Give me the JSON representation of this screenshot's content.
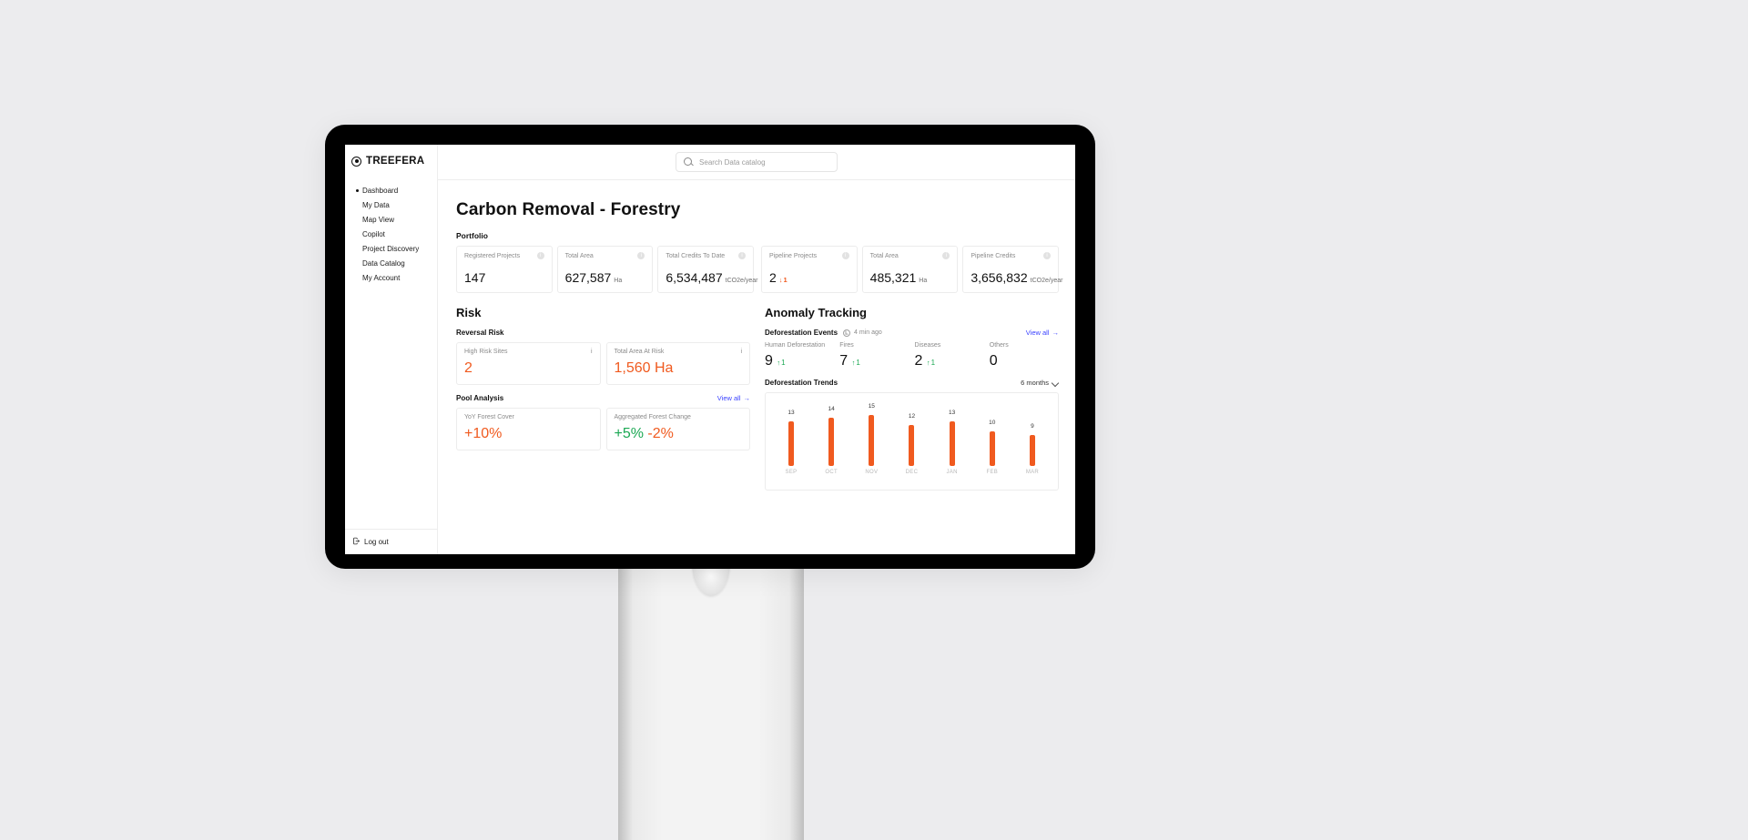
{
  "brand": "TREEFERA",
  "search": {
    "placeholder": "Search Data catalog"
  },
  "sidebar": {
    "items": [
      {
        "label": "Dashboard",
        "active": true
      },
      {
        "label": "My Data"
      },
      {
        "label": "Map View"
      },
      {
        "label": "Copilot"
      },
      {
        "label": "Project Discovery"
      },
      {
        "label": "Data Catalog"
      },
      {
        "label": "My Account"
      }
    ],
    "logout_label": "Log out"
  },
  "page": {
    "title": "Carbon Removal - Forestry"
  },
  "portfolio": {
    "title": "Portfolio",
    "left": [
      {
        "label": "Registered Projects",
        "value": "147"
      },
      {
        "label": "Total Area",
        "value": "627,587",
        "unit": "Ha"
      },
      {
        "label": "Total Credits To Date",
        "value": "6,534,487",
        "unit": "tCO2e/year"
      }
    ],
    "right": [
      {
        "label": "Pipeline Projects",
        "value": "2",
        "delta_dir": "down",
        "delta": "1"
      },
      {
        "label": "Total Area",
        "value": "485,321",
        "unit": "Ha"
      },
      {
        "label": "Pipeline Credits",
        "value": "3,656,832",
        "unit": "tCO2e/year"
      }
    ]
  },
  "risk": {
    "title": "Risk",
    "reversal": {
      "title": "Reversal Risk",
      "items": [
        {
          "label": "High Risk Sites",
          "value": "2",
          "color": "orange"
        },
        {
          "label": "Total Area At Risk",
          "value": "1,560",
          "unit": "Ha",
          "color": "orange"
        }
      ]
    },
    "pool": {
      "title": "Pool Analysis",
      "view_all": "View all",
      "items": [
        {
          "label": "YoY Forest Cover",
          "value": "+10%",
          "color": "orange"
        },
        {
          "label": "Aggregated Forest Change",
          "value": "+5%",
          "value2": "-2%",
          "color": "green",
          "color2": "orange"
        }
      ]
    }
  },
  "anomaly": {
    "title": "Anomaly Tracking",
    "events": {
      "title": "Deforestation Events",
      "ago": "4 min ago",
      "view_all": "View all",
      "tiles": [
        {
          "label": "Human Deforestation",
          "value": "9",
          "delta_dir": "up",
          "delta": "1"
        },
        {
          "label": "Fires",
          "value": "7",
          "delta_dir": "up",
          "delta": "1"
        },
        {
          "label": "Diseases",
          "value": "2",
          "delta_dir": "up",
          "delta": "1"
        },
        {
          "label": "Others",
          "value": "0"
        }
      ]
    },
    "trends": {
      "title": "Deforestation Trends",
      "range": "6 months"
    }
  },
  "chart_data": {
    "type": "bar",
    "categories": [
      "SEP",
      "OCT",
      "NOV",
      "DEC",
      "JAN",
      "FEB",
      "MAR"
    ],
    "values": [
      13,
      14,
      15,
      12,
      13,
      10,
      9
    ],
    "title": "Deforestation Trends",
    "xlabel": "",
    "ylabel": "",
    "ylim": [
      0,
      16
    ]
  }
}
